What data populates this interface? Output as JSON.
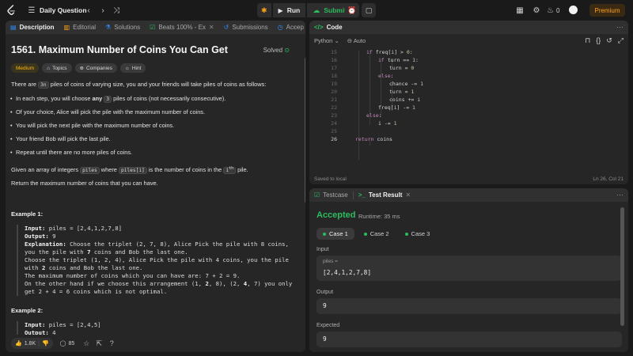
{
  "topbar": {
    "title": "Daily Question",
    "run_label": "Run",
    "submit_label": "Submit",
    "streak": "0",
    "premium_label": "Premium"
  },
  "left_tabs": [
    {
      "label": "Description"
    },
    {
      "label": "Editorial"
    },
    {
      "label": "Solutions"
    },
    {
      "label": "Beats 100% - Ex"
    },
    {
      "label": "Submissions"
    },
    {
      "label": "Accep"
    }
  ],
  "problem": {
    "title": "1561. Maximum Number of Coins You Can Get",
    "status": "Solved",
    "difficulty": "Medium",
    "tags": [
      "Topics",
      "Companies",
      "Hint"
    ],
    "intro_pre": "There are ",
    "intro_code": "3n",
    "intro_post": " piles of coins of varying size, you and your friends will take piles of coins as follows:",
    "bullets": [
      {
        "pre": "In each step, you will choose ",
        "bold": "any",
        "code": "3",
        "post": " piles of coins (not necessarily consecutive)."
      },
      {
        "text": "Of your choice, Alice will pick the pile with the maximum number of coins."
      },
      {
        "text": "You will pick the next pile with the maximum number of coins."
      },
      {
        "text": "Your friend Bob will pick the last pile."
      },
      {
        "text": "Repeat until there are no more piles of coins."
      }
    ],
    "given_pre": "Given an array of integers ",
    "given_code1": "piles",
    "given_mid": " where ",
    "given_code2": "piles[i]",
    "given_post1": " is the number of coins in the ",
    "given_sup": "i",
    "given_sup2": "th",
    "given_post2": " pile.",
    "return_text": "Return the maximum number of coins that you can have.",
    "ex1_title": "Example 1:",
    "ex2_title": "Example 2:",
    "ex1_input_label": "Input:",
    "ex1_input": " piles = [2,4,1,2,7,8]",
    "ex1_output_label": "Output:",
    "ex1_output": " 9",
    "ex1_expl_label": "Explanation:",
    "ex1_l1": " Choose the triplet (2, 7, 8), Alice Pick the pile with 8 coins,",
    "ex1_l2a": "you the pile with ",
    "ex1_l2b": "7",
    "ex1_l2c": " coins and Bob the last one.",
    "ex1_l3": "Choose the triplet (1, 2, 4), Alice Pick the pile with 4 coins, you the pile",
    "ex1_l4a": "with ",
    "ex1_l4b": "2",
    "ex1_l4c": " coins and Bob the last one.",
    "ex1_l5": "The maximum number of coins which you can have are: 7 + 2 = 9.",
    "ex1_l6a": "On the other hand if we choose this arrangement (1, ",
    "ex1_l6b": "2",
    "ex1_l6c": ", 8), (2, ",
    "ex1_l6d": "4",
    "ex1_l6e": ", 7) you only",
    "ex1_l7": "get 2 + 4 = 6 coins which is not optimal.",
    "ex2_input_label": "Input:",
    "ex2_input": " piles = [2,4,5]",
    "ex2_output_label": "Output:",
    "ex2_output": " 4"
  },
  "footer": {
    "likes": "1.8K",
    "comments": "85"
  },
  "code_panel": {
    "title": "Code",
    "language": "Python",
    "auto": "Auto",
    "saved": "Saved to local",
    "cursor": "Ln 26, Col 21",
    "lines": [
      {
        "n": "15",
        "t": "if freq[i] > 0:"
      },
      {
        "n": "16",
        "t": "if turn == 1:"
      },
      {
        "n": "17",
        "t": "turn = 0"
      },
      {
        "n": "18",
        "t": "else:"
      },
      {
        "n": "19",
        "t": "chance -= 1"
      },
      {
        "n": "20",
        "t": "turn = 1"
      },
      {
        "n": "21",
        "t": "coins += i"
      },
      {
        "n": "22",
        "t": "freq[i] -= 1"
      },
      {
        "n": "23",
        "t": "else:"
      },
      {
        "n": "24",
        "t": "i -= 1"
      },
      {
        "n": "25",
        "t": ""
      },
      {
        "n": "26",
        "t": "return coins"
      }
    ]
  },
  "result_panel": {
    "testcase_tab": "Testcase",
    "result_tab": "Test Result",
    "verdict": "Accepted",
    "runtime": "Runtime: 35 ms",
    "cases": [
      "Case 1",
      "Case 2",
      "Case 3"
    ],
    "input_label": "Input",
    "input_var": "piles =",
    "input_value": "[2,4,1,2,7,8]",
    "output_label": "Output",
    "output_value": "9",
    "expected_label": "Expected",
    "expected_value": "9"
  },
  "colors": {
    "accent_green": "#2cbb5d",
    "premium_orange": "#ffa116",
    "medium_yellow": "#ffb800"
  }
}
